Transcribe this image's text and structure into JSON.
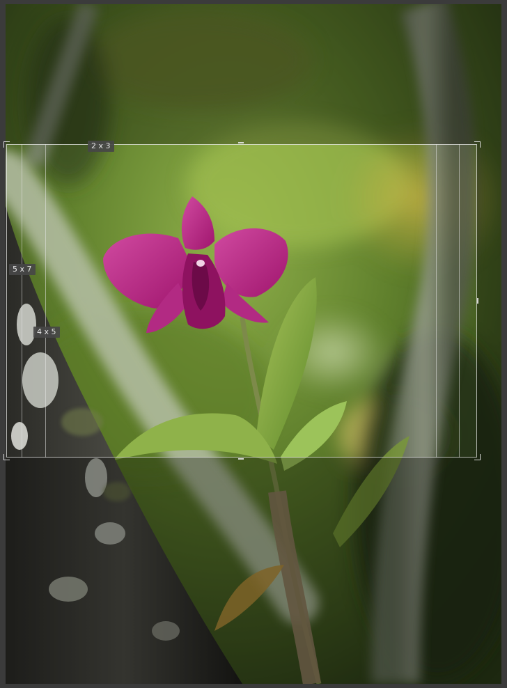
{
  "crop_overlay": {
    "ratio_labels": [
      "2 x 3",
      "5 x 7",
      "4 x 5"
    ]
  },
  "colors": {
    "frame": "#3b3b3b",
    "overlay_line": "#e6e6e6",
    "label_bg": "#464646",
    "orchid": "#b4217e"
  }
}
